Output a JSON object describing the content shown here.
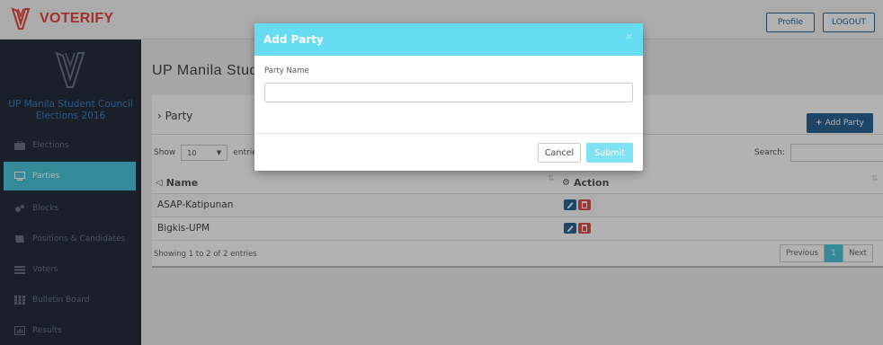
{
  "app": {
    "brand": "VOTERIFY"
  },
  "topbar": {
    "profile_label": "Profile",
    "logout_label": "LOGOUT"
  },
  "sidebar": {
    "title": "UP Manila Student Council Elections 2016",
    "items": [
      {
        "label": "Elections",
        "icon": "briefcase-icon"
      },
      {
        "label": "Parties",
        "icon": "monitor-icon",
        "active": true
      },
      {
        "label": "Blocks",
        "icon": "gears-icon"
      },
      {
        "label": "Positions & Candidates",
        "icon": "book-icon"
      },
      {
        "label": "Voters",
        "icon": "list-icon"
      },
      {
        "label": "Bulletin Board",
        "icon": "grid-icon"
      },
      {
        "label": "Results",
        "icon": "bar-chart-icon"
      }
    ]
  },
  "main": {
    "heading": "UP Manila Stud",
    "panel_title": "› Party",
    "add_button": "Add Party",
    "show_label": "Show",
    "entries_value": "10",
    "entries_label": "entries",
    "search_label": "Search:",
    "columns": [
      "Name",
      "Action"
    ],
    "rows": [
      {
        "name": "ASAP-Katipunan"
      },
      {
        "name": "Bigkis-UPM"
      }
    ],
    "info": "Showing 1 to 2 of 2 entries",
    "pager": {
      "previous": "Previous",
      "page": "1",
      "next": "Next"
    }
  },
  "modal": {
    "title": "Add Party",
    "close": "×",
    "field_label": "Party Name",
    "field_value": "",
    "cancel_label": "Cancel",
    "submit_label": "Submit"
  },
  "colors": {
    "brand_red": "#e8463a",
    "sidebar_bg": "#252e3d",
    "accent_cyan": "#4bc6dc",
    "modal_header": "#65dcef",
    "primary_blue": "#2a6496",
    "danger_red": "#d9534f"
  }
}
